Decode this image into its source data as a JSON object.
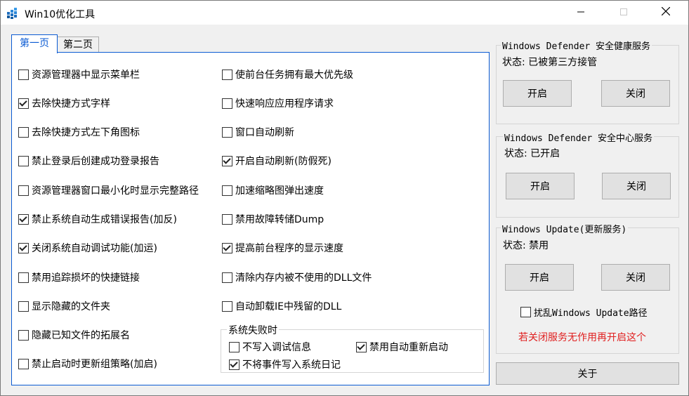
{
  "window": {
    "title": "Win10优化工具",
    "icon": "app-grid-icon",
    "controls": [
      "minimize-icon",
      "maximize-icon",
      "close-icon"
    ]
  },
  "tabs": [
    {
      "label": "第一页",
      "selected": true
    },
    {
      "label": "第二页",
      "selected": false
    }
  ],
  "page1": {
    "left_column": [
      {
        "label": "资源管理器中显示菜单栏",
        "checked": false
      },
      {
        "label": "去除快捷方式字样",
        "checked": true
      },
      {
        "label": "去除快捷方式左下角图标",
        "checked": false
      },
      {
        "label": "禁止登录后创建成功登录报告",
        "checked": false
      },
      {
        "label": "资源管理器窗口最小化时显示完整路径",
        "checked": false
      },
      {
        "label": "禁止系统自动生成错误报告(加反)",
        "checked": true
      },
      {
        "label": "关闭系统自动调试功能(加运)",
        "checked": true
      },
      {
        "label": "禁用追踪损坏的快捷链接",
        "checked": false
      },
      {
        "label": "显示隐藏的文件夹",
        "checked": false
      },
      {
        "label": "隐藏已知文件的拓展名",
        "checked": false
      },
      {
        "label": "禁止启动时更新组策略(加启)",
        "checked": false
      }
    ],
    "right_column": [
      {
        "label": "使前台任务拥有最大优先级",
        "checked": false
      },
      {
        "label": "快速响应应用程序请求",
        "checked": false
      },
      {
        "label": "窗口自动刷新",
        "checked": false
      },
      {
        "label": "开启自动刷新(防假死)",
        "checked": true
      },
      {
        "label": "加速缩略图弹出速度",
        "checked": false
      },
      {
        "label": "禁用故障转储Dump",
        "checked": false
      },
      {
        "label": "提高前台程序的显示速度",
        "checked": true
      },
      {
        "label": "清除内存内被不使用的DLL文件",
        "checked": false
      },
      {
        "label": "自动卸载IE中残留的DLL",
        "checked": false
      }
    ],
    "system_failure": {
      "title": "系统失败时",
      "options": [
        {
          "label": "不写入调试信息",
          "checked": false
        },
        {
          "label": "禁用自动重新启动",
          "checked": true
        },
        {
          "label": "不将事件写入系统日记",
          "checked": true
        }
      ]
    }
  },
  "services": [
    {
      "title": "Windows Defender 安全健康服务",
      "status": "状态: 已被第三方接管",
      "on_label": "开启",
      "off_label": "关闭"
    },
    {
      "title": "Windows Defender 安全中心服务",
      "status": "状态: 已开启",
      "on_label": "开启",
      "off_label": "关闭"
    },
    {
      "title": "Windows Update(更新服务)",
      "status": "状态: 禁用",
      "on_label": "开启",
      "off_label": "关闭"
    }
  ],
  "update_path": {
    "label": "扰乱Windows Update路径",
    "checked": false
  },
  "note": {
    "text": "若关闭服务无作用再开启这个",
    "color": "#e02020"
  },
  "about_label": "关于",
  "colors": {
    "accent": "#0b5bd3"
  }
}
